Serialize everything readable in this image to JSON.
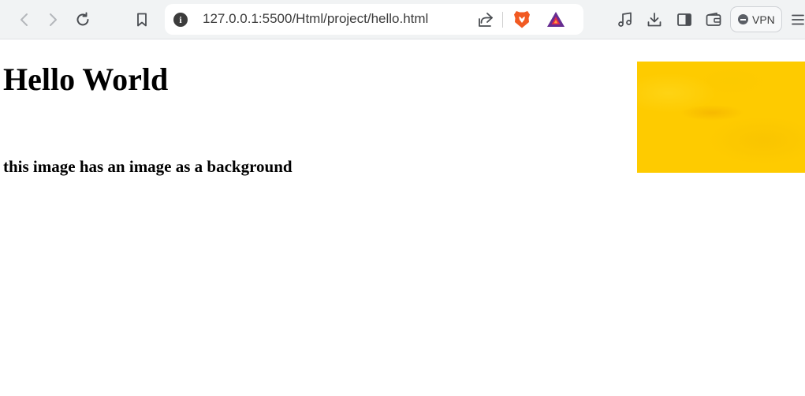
{
  "browser": {
    "url": "127.0.0.1:5500/Html/project/hello.html",
    "vpn_label": "VPN",
    "icons": {
      "back": "chevron-left-icon",
      "forward": "chevron-right-icon",
      "reload": "reload-icon",
      "bookmark": "bookmark-icon",
      "site_info": "info-icon",
      "share": "share-icon",
      "brave_shields": "brave-lion-icon",
      "rewards": "bat-triangle-icon",
      "media": "music-note-icon",
      "downloads": "download-icon",
      "sidebar": "sidebar-icon",
      "wallet": "wallet-icon",
      "menu": "hamburger-menu-icon"
    },
    "colors": {
      "toolbar": "#f1f3f4",
      "brave_orange": "#f15a22",
      "bat_purple": "#662d91",
      "bat_red": "#e0284b"
    }
  },
  "page": {
    "heading": "Hello World",
    "subheading": "this image has an image as a background",
    "image_color": "#fecb00"
  }
}
